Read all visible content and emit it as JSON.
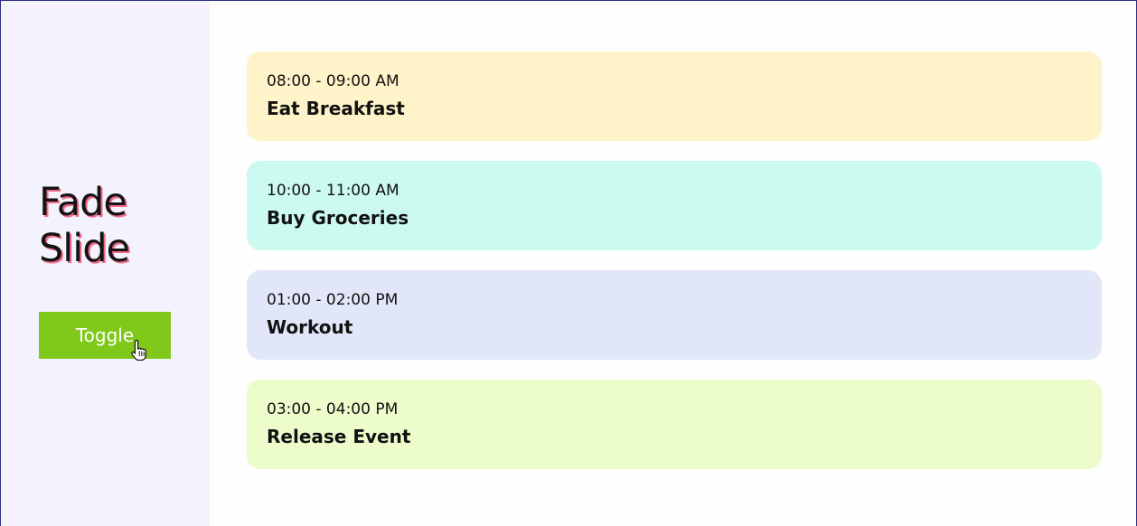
{
  "sidebar": {
    "title_line_1": "Fade",
    "title_line_2": "Slide",
    "toggle_label": "Toggle",
    "cursor_icon": "hand-pointer-icon"
  },
  "events": [
    {
      "time": "08:00 - 09:00 AM",
      "title": "Eat Breakfast",
      "background_color": "#fff3c9"
    },
    {
      "time": "10:00 - 11:00 AM",
      "title": "Buy Groceries",
      "background_color": "#ccfaf0"
    },
    {
      "time": "01:00 - 02:00 PM",
      "title": "Workout",
      "background_color": "#e1e6f8"
    },
    {
      "time": "03:00 - 04:00 PM",
      "title": "Release Event",
      "background_color": "#ecfccb"
    }
  ],
  "colors": {
    "sidebar_background": "#f3f2fd",
    "toggle_background": "#80c91b",
    "title_shadow": "#f06a88"
  }
}
